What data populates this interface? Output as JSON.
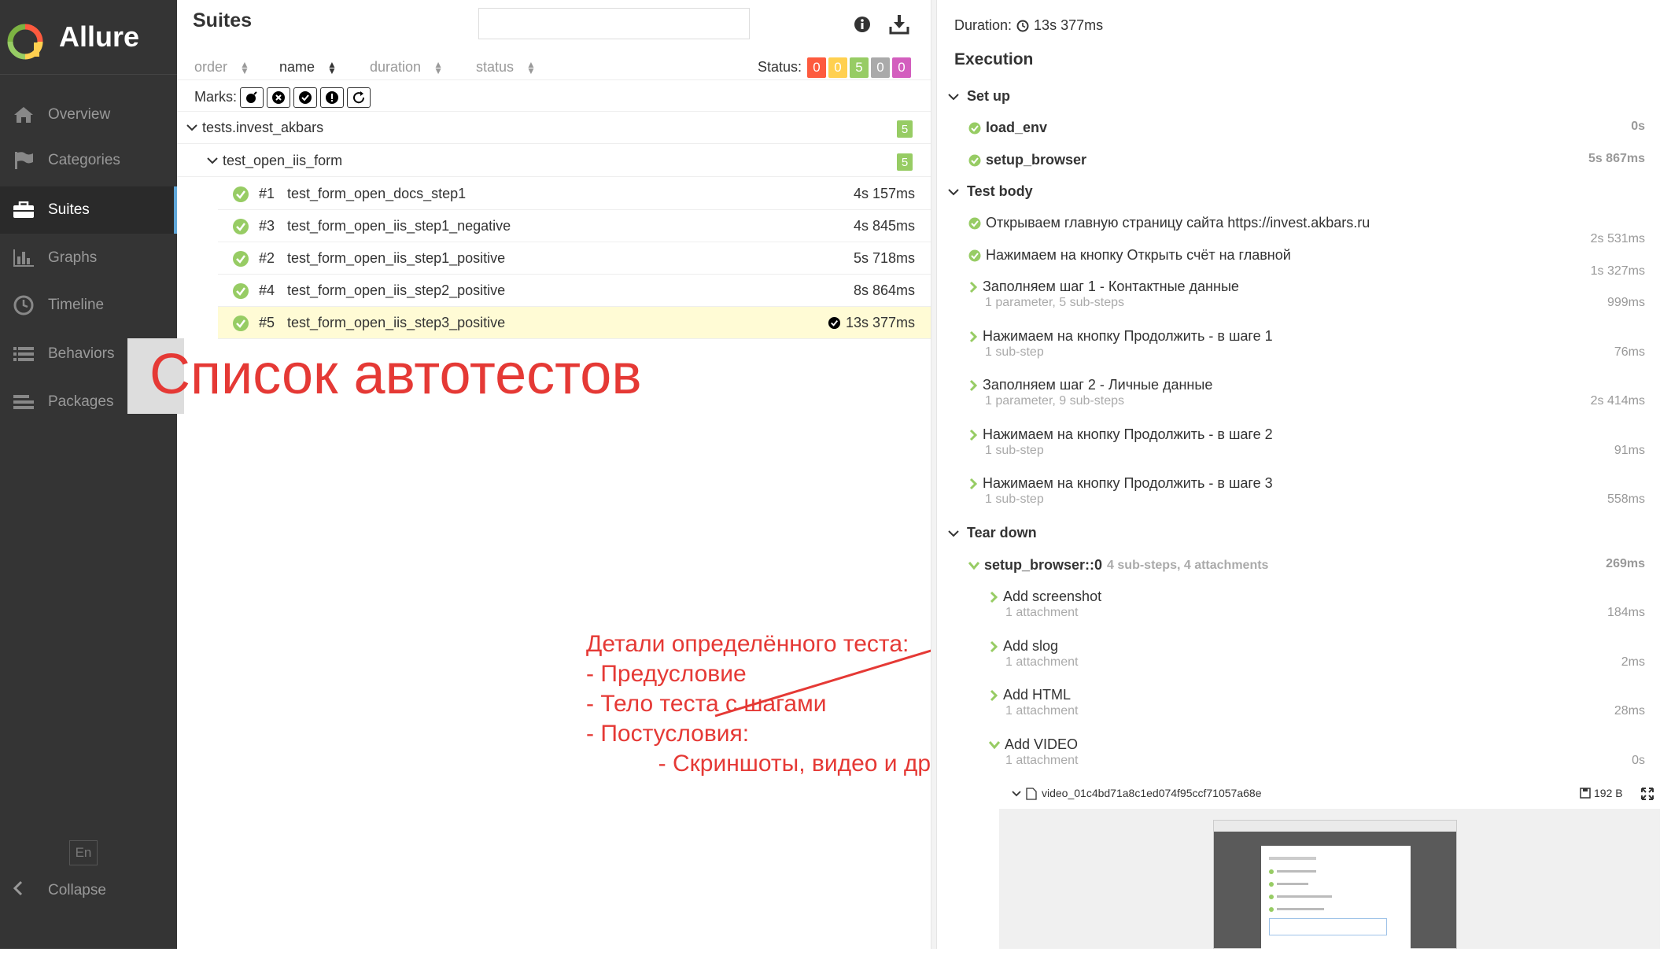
{
  "app": {
    "name": "Allure"
  },
  "sidebar": {
    "items": [
      {
        "label": "Overview",
        "icon": "home-icon"
      },
      {
        "label": "Categories",
        "icon": "flag-icon"
      },
      {
        "label": "Suites",
        "icon": "briefcase-icon"
      },
      {
        "label": "Graphs",
        "icon": "bar-chart-icon"
      },
      {
        "label": "Timeline",
        "icon": "clock-icon"
      },
      {
        "label": "Behaviors",
        "icon": "list-icon"
      },
      {
        "label": "Packages",
        "icon": "lines-icon"
      }
    ],
    "active": "Suites",
    "lang": "En",
    "collapse_label": "Collapse"
  },
  "suites": {
    "title": "Suites",
    "sort": {
      "order": "order",
      "name": "name",
      "duration": "duration",
      "status": "status"
    },
    "status_label": "Status:",
    "status_counts": [
      {
        "value": "0",
        "color": "#fd5a3e"
      },
      {
        "value": "0",
        "color": "#ffd050"
      },
      {
        "value": "5",
        "color": "#97cc64"
      },
      {
        "value": "0",
        "color": "#aaaaaa"
      },
      {
        "value": "0",
        "color": "#d35ebe"
      }
    ],
    "marks_label": "Marks:",
    "package": {
      "name": "tests.invest_akbars",
      "count": "5"
    },
    "module": {
      "name": "test_open_iis_form",
      "count": "5"
    },
    "tests": [
      {
        "num": "#1",
        "name": "test_form_open_docs_step1",
        "duration": "4s 157ms"
      },
      {
        "num": "#3",
        "name": "test_form_open_iis_step1_negative",
        "duration": "4s 845ms"
      },
      {
        "num": "#2",
        "name": "test_form_open_iis_step1_positive",
        "duration": "5s 718ms"
      },
      {
        "num": "#4",
        "name": "test_form_open_iis_step2_positive",
        "duration": "8s 864ms"
      },
      {
        "num": "#5",
        "name": "test_form_open_iis_step3_positive",
        "duration": "13s 377ms"
      }
    ]
  },
  "annotations": {
    "big": "Список автотестов",
    "details": "Детали определённого теста:\n- Предусловие\n- Тело теста с шагами\n- Постусловия:\n           - Скриншоты, видео и др."
  },
  "details": {
    "duration_label": "Duration:",
    "duration_value": "13s 377ms",
    "execution_title": "Execution",
    "setup": {
      "title": "Set up",
      "steps": [
        {
          "name": "load_env",
          "time": "0s"
        },
        {
          "name": "setup_browser",
          "time": "5s 867ms"
        }
      ]
    },
    "body": {
      "title": "Test body",
      "steps": [
        {
          "name": "Открываем главную страницу сайта https://invest.akbars.ru",
          "sub": "",
          "time": "2s 531ms"
        },
        {
          "name": "Нажимаем на кнопку Открыть счёт на главной",
          "sub": "",
          "time": "1s 327ms"
        },
        {
          "name": "Заполняем шаг 1 - Контактные данные",
          "sub": "1 parameter, 5 sub-steps",
          "time": "999ms"
        },
        {
          "name": "Нажимаем на кнопку Продолжить - в шаге 1",
          "sub": "1 sub-step",
          "time": "76ms"
        },
        {
          "name": "Заполняем шаг 2 - Личные данные",
          "sub": "1 parameter, 9 sub-steps",
          "time": "2s 414ms"
        },
        {
          "name": "Нажимаем на кнопку Продолжить - в шаге 2",
          "sub": "1 sub-step",
          "time": "91ms"
        },
        {
          "name": "Нажимаем на кнопку Продолжить - в шаге 3",
          "sub": "1 sub-step",
          "time": "558ms"
        }
      ]
    },
    "teardown": {
      "title": "Tear down",
      "fixture": {
        "name": "setup_browser::0",
        "sub": "4 sub-steps, 4 attachments",
        "time": "269ms"
      },
      "steps": [
        {
          "name": "Add screenshot",
          "sub": "1 attachment",
          "time": "184ms"
        },
        {
          "name": "Add slog",
          "sub": "1 attachment",
          "time": "2ms"
        },
        {
          "name": "Add HTML",
          "sub": "1 attachment",
          "time": "28ms"
        },
        {
          "name": "Add VIDEO",
          "sub": "1 attachment",
          "time": "0s"
        }
      ],
      "attachment": {
        "name": "video_01c4bd71a8c1ed074f95ccf71057a68e",
        "size": "192 B"
      }
    }
  }
}
